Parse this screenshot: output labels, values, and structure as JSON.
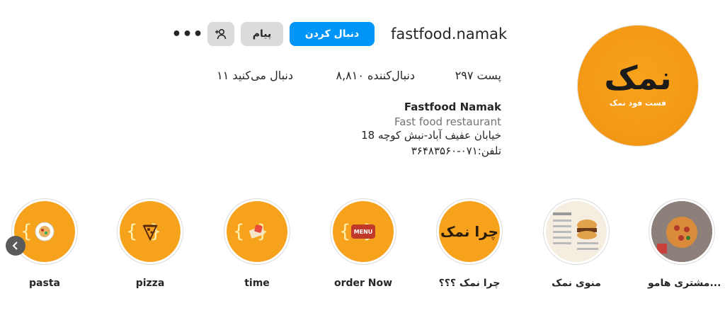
{
  "profile": {
    "username": "fastfood.namak",
    "follow_label": "دنبال کردن",
    "message_label": "پیام",
    "add_user_icon": "add-user-icon",
    "more_label": "•••",
    "avatar": {
      "logo_text": "نمک",
      "logo_subtext": "فست فود نمک"
    }
  },
  "stats": {
    "posts": "۲۹۷ پست",
    "followers": "۸,۸۱۰ دنبال‌کننده",
    "following": "۱۱ دنبال می‌کنید"
  },
  "bio": {
    "name": "Fastfood Namak",
    "category": "Fast food restaurant",
    "address": "خیابان عفیف آباد-نبش کوچه 18",
    "phone": "تلفن:۰۷۱-۳۶۴۸۳۵۶۰"
  },
  "highlights": [
    {
      "label": "pasta",
      "icon": "pasta-icon"
    },
    {
      "label": "pizza",
      "icon": "pizza-slice-icon"
    },
    {
      "label": "time",
      "icon": "time-icon"
    },
    {
      "label": "order Now",
      "icon": "menu-badge-icon",
      "badge_text": "MENU"
    },
    {
      "label": "چرا نمک ؟؟؟",
      "icon": "text-cover",
      "cover_text": "چرا نمک"
    },
    {
      "label": "منوی نمک",
      "icon": "menu-photo"
    },
    {
      "label": "مشتری هامو...",
      "icon": "customer-photo"
    }
  ],
  "colors": {
    "accent": "#0095f6",
    "brand_orange": "#f6a21d"
  }
}
